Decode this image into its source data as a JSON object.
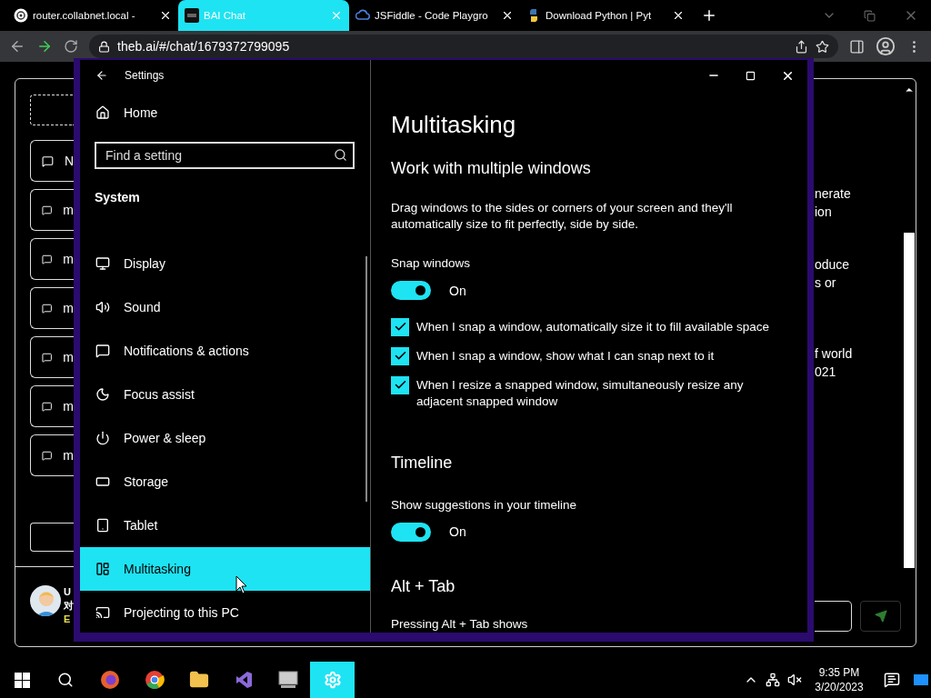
{
  "browser": {
    "tabs": [
      {
        "title": "router.collabnet.local -",
        "selected": false
      },
      {
        "title": "BAI Chat",
        "selected": true
      },
      {
        "title": "JSFiddle - Code Playgro",
        "selected": false
      },
      {
        "title": "Download Python | Pyt",
        "selected": false
      }
    ],
    "url": "theb.ai/#/chat/1679372799095"
  },
  "chat_page": {
    "sidebar_items": [
      "N",
      "m",
      "m",
      "m",
      "m",
      "m",
      "m"
    ],
    "user": {
      "name": "U",
      "line_2": "对",
      "line_3": "E"
    },
    "message_fragments": [
      "nerate",
      "ion",
      "oduce",
      "s or",
      "f world",
      "021"
    ]
  },
  "settings": {
    "title": "Settings",
    "home": "Home",
    "search": {
      "placeholder": "Find a setting"
    },
    "section": "System",
    "nav": [
      {
        "label": "Display",
        "selected": false
      },
      {
        "label": "Sound",
        "selected": false
      },
      {
        "label": "Notifications & actions",
        "selected": false
      },
      {
        "label": "Focus assist",
        "selected": false
      },
      {
        "label": "Power & sleep",
        "selected": false
      },
      {
        "label": "Storage",
        "selected": false
      },
      {
        "label": "Tablet",
        "selected": false
      },
      {
        "label": "Multitasking",
        "selected": true
      },
      {
        "label": "Projecting to this PC",
        "selected": false
      }
    ],
    "page_title": "Multitasking",
    "sections": [
      {
        "heading": "Work with multiple windows",
        "description": "Drag windows to the sides or corners of your screen and they'll automatically size to fit perfectly, side by side.",
        "items": [
          {
            "kind": "toggle",
            "label": "Snap windows",
            "on": true,
            "state_text": "On"
          },
          {
            "kind": "checkbox",
            "label": "When I snap a window, automatically size it to fill available space",
            "checked": true
          },
          {
            "kind": "checkbox",
            "label": "When I snap a window, show what I can snap next to it",
            "checked": true
          },
          {
            "kind": "checkbox",
            "label": "When I resize a snapped window, simultaneously resize any adjacent snapped window",
            "checked": true
          }
        ]
      },
      {
        "heading": "Timeline",
        "items": [
          {
            "kind": "toggle",
            "label": "Show suggestions in your timeline",
            "on": true,
            "state_text": "On"
          }
        ]
      },
      {
        "heading": "Alt + Tab",
        "items": [
          {
            "kind": "text",
            "label": "Pressing Alt + Tab shows"
          }
        ]
      }
    ]
  },
  "taskbar": {
    "apps": [
      {
        "selected": false
      },
      {
        "selected": false
      },
      {
        "selected": false
      },
      {
        "selected": false
      },
      {
        "selected": false
      },
      {
        "selected": true
      }
    ],
    "time": "9:35 PM",
    "date": "3/20/2023"
  }
}
